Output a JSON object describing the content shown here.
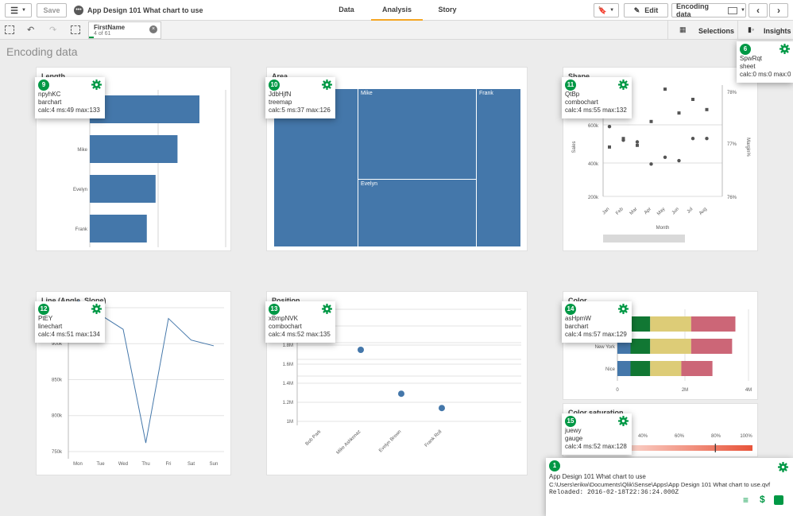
{
  "topbar": {
    "save_label": "Save",
    "app_title": "App Design 101 What chart to use",
    "tabs": [
      {
        "label": "Data"
      },
      {
        "label": "Analysis"
      },
      {
        "label": "Story"
      }
    ],
    "edit_label": "Edit",
    "sheet_label": "Encoding data"
  },
  "toolbar2": {
    "selection": {
      "field": "FirstName",
      "count": "4 of 61"
    },
    "selections_label": "Selections",
    "insights_label": "Insights"
  },
  "sheet_title": "Encoding data",
  "colors": {
    "accent": "#009845",
    "bar": "#4477aa",
    "tab_underline": "#f5a623"
  },
  "panels": {
    "length": {
      "title": "Length"
    },
    "area": {
      "title": "Area"
    },
    "shape": {
      "title": "Shape"
    },
    "line": {
      "title": "Line (Angle, Slope)"
    },
    "position": {
      "title": "Position"
    },
    "color": {
      "title": "Color"
    },
    "saturation": {
      "title": "Color saturation"
    }
  },
  "tooltips": {
    "t6": {
      "badge": "6",
      "id": "SpwRqt",
      "type": "sheet",
      "stats": "calc:0 ms:0 max:0"
    },
    "t9": {
      "badge": "9",
      "id": "npyhKC",
      "type": "barchart",
      "stats": "calc:4 ms:49 max:133"
    },
    "t10": {
      "badge": "10",
      "id": "JdbHjfN",
      "type": "treemap",
      "stats": "calc:5 ms:37 max:126"
    },
    "t11": {
      "badge": "11",
      "id": "QtBp",
      "type": "combochart",
      "stats": "calc:4 ms:55 max:132"
    },
    "t12": {
      "badge": "12",
      "id": "PtEY",
      "type": "linechart",
      "stats": "calc:4 ms:51 max:134"
    },
    "t13": {
      "badge": "13",
      "id": "xBmpNVK",
      "type": "combochart",
      "stats": "calc:4 ms:52 max:135"
    },
    "t14": {
      "badge": "14",
      "id": "asHpmW",
      "type": "barchart",
      "stats": "calc:4 ms:57 max:129"
    },
    "t15": {
      "badge": "15",
      "id": "juewy",
      "type": "gauge",
      "stats": "calc:4 ms:52 max:128"
    }
  },
  "app_info": {
    "badge": "1",
    "name": "App Design 101 What chart to use",
    "path": "C:\\Users\\erikw\\Documents\\Qlik\\Sense\\Apps\\App Design 101 What chart to use.qvf",
    "reloaded": "Reloaded: 2016-02-18T22:36:24.000Z"
  },
  "chart_data": [
    {
      "type": "bar",
      "title": "Length",
      "categories": [
        "Bob",
        "Mike",
        "Evelyn",
        "Frank"
      ],
      "values": [
        100,
        80,
        60,
        52
      ]
    },
    {
      "type": "treemap",
      "title": "Area",
      "categories": [
        "Bob",
        "Mike",
        "Frank",
        "Evelyn"
      ],
      "labels_shown": [
        "Mike",
        "Frank",
        "Evelyn"
      ]
    },
    {
      "type": "scatter",
      "title": "Shape",
      "categories": [
        "Jan",
        "Feb",
        "Mar",
        "Apr",
        "May",
        "Jun",
        "Jul",
        "Aug"
      ],
      "ylabel": "Sales",
      "y2label": "Margin%",
      "xlabel": "Month",
      "y_ticks": [
        "200k",
        "400k",
        "600k"
      ],
      "y2_ticks": [
        "76%",
        "77%",
        "78%"
      ],
      "series": [
        {
          "values": [
            570000,
            490000,
            480000,
            350000,
            390000,
            370000,
            500000,
            500000
          ]
        },
        {
          "values": [
            450000,
            500000,
            460000,
            600000,
            790000,
            650000,
            730000,
            670000
          ]
        }
      ]
    },
    {
      "type": "line",
      "title": "Line (Angle, Slope)",
      "categories": [
        "Mon",
        "Tue",
        "Wed",
        "Thu",
        "Fri",
        "Sat",
        "Sun"
      ],
      "y_ticks": [
        "750k",
        "800k",
        "850k",
        "900k"
      ],
      "ylim": [
        740000,
        950000
      ],
      "values": [
        960000,
        940000,
        920000,
        762000,
        935000,
        905000,
        897000
      ]
    },
    {
      "type": "scatter",
      "title": "Position",
      "categories": [
        "Bob Park",
        "Mike Ashkenaz",
        "Evelyn Brown",
        "Frank Roll"
      ],
      "y_ticks": [
        "1M",
        "1.2M",
        "1.4M",
        "1.6M",
        "1.8M"
      ],
      "ylim": [
        1000000,
        2000000
      ],
      "values": [
        null,
        1750000,
        1290000,
        1140000
      ]
    },
    {
      "type": "bar",
      "title": "Color",
      "categories": [
        "",
        "New York",
        "Nice"
      ],
      "x_ticks": [
        "0",
        "2M",
        "4M"
      ],
      "xlim": [
        0,
        4000000
      ],
      "series": [
        {
          "color": "#4477aa",
          "values": [
            400000,
            400000,
            400000
          ]
        },
        {
          "color": "#117733",
          "values": [
            600000,
            600000,
            600000
          ]
        },
        {
          "color": "#ddcc77",
          "values": [
            1250000,
            1250000,
            950000
          ]
        },
        {
          "color": "#cc6677",
          "values": [
            1350000,
            1250000,
            950000
          ]
        }
      ]
    },
    {
      "type": "gauge",
      "title": "Color saturation",
      "x_ticks": [
        "40%",
        "60%",
        "80%",
        "100%"
      ],
      "value": 0.79
    }
  ]
}
